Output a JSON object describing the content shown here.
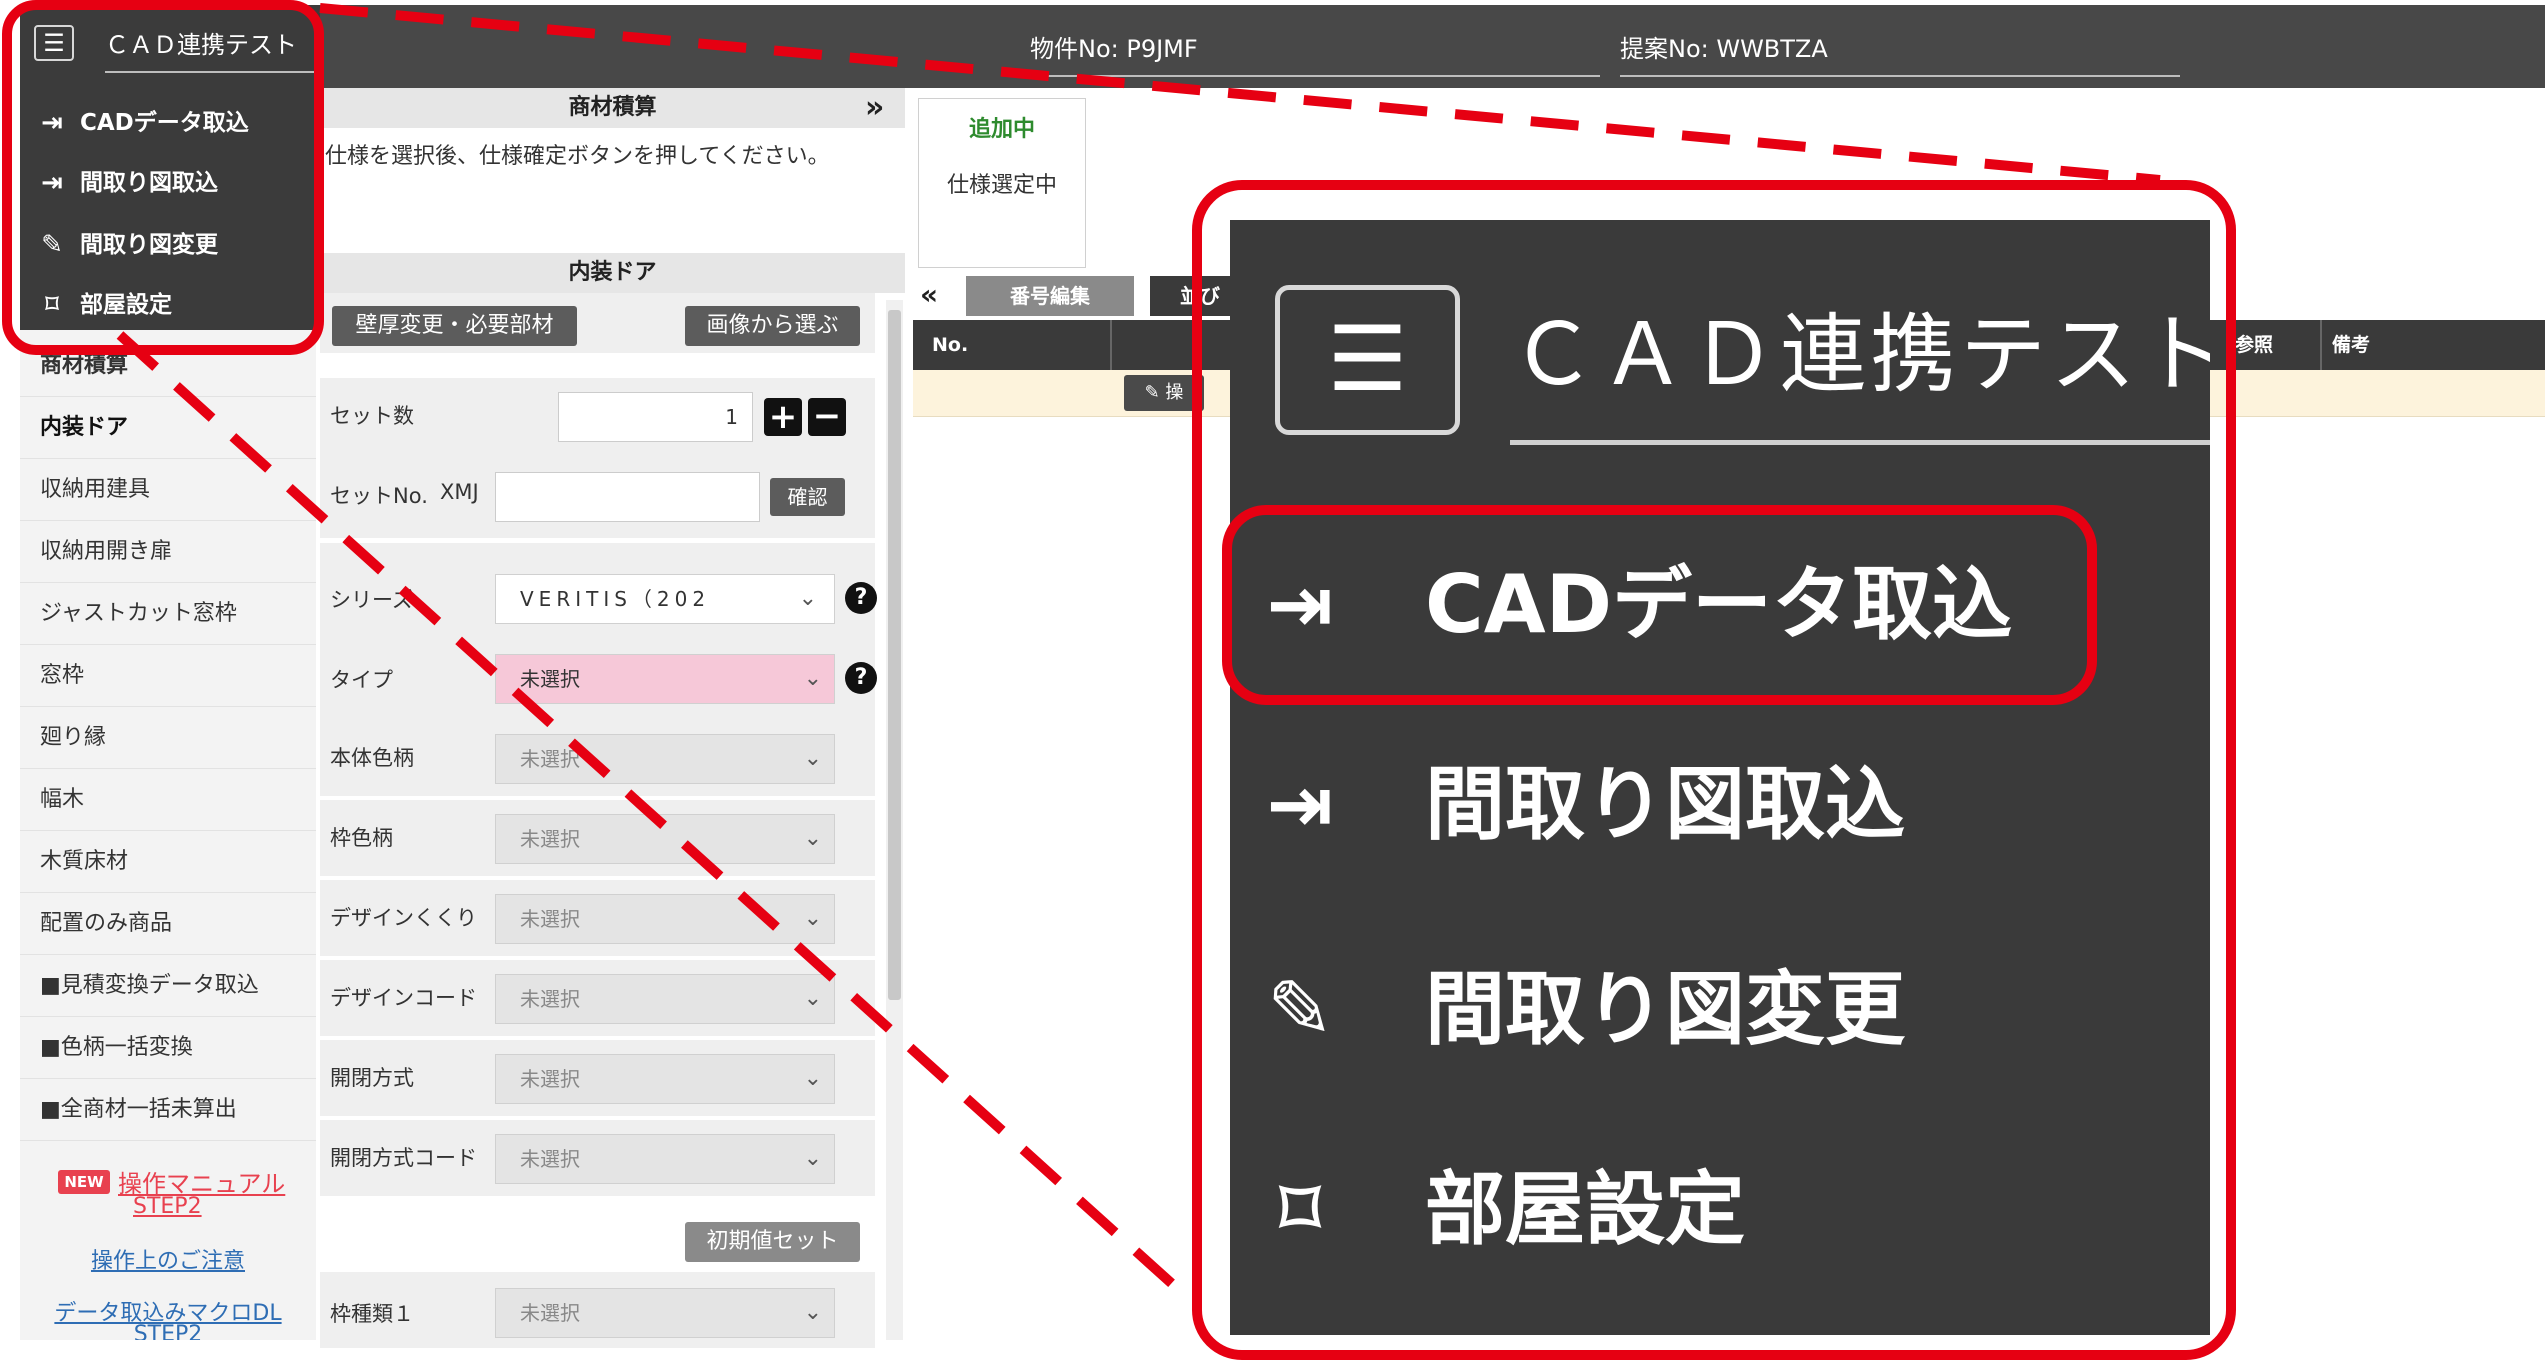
{
  "header": {
    "menu_icon": "hamburger-icon",
    "app_title": "ＣＡＤ連携テスト",
    "property_no": "物件No: P9JMF",
    "proposal_no": "提案No: WWBTZA"
  },
  "menu": {
    "items": [
      {
        "icon": "file-import-icon",
        "label": "CADデータ取込"
      },
      {
        "icon": "file-import-icon",
        "label": "間取り図取込"
      },
      {
        "icon": "edit-icon",
        "label": "間取り図変更"
      },
      {
        "icon": "room-shape-icon",
        "label": "部屋設定"
      }
    ]
  },
  "sidebar": {
    "items": [
      "商材積算",
      "内装ドア",
      "収納用建具",
      "収納用開き扉",
      "ジャストカット窓枠",
      "窓枠",
      "廻り縁",
      "幅木",
      "木質床材",
      "配置のみ商品",
      "■見積変換データ取込",
      "■色柄一括変換",
      "■全商材一括未算出"
    ],
    "new_badge": "NEW",
    "manual_link": "操作マニュアル",
    "manual_step": "STEP2",
    "notes_link": "操作上のご注意",
    "macro_link": "データ取込みマクロDL",
    "macro_step": "STEP2"
  },
  "form": {
    "section1_title": "商材積算",
    "collapse_icon": "»",
    "instruction": "仕様を選択後、仕様確定ボタンを押してください。",
    "section2_title": "内装ドア",
    "wall_button": "壁厚変更・必要部材",
    "image_button": "画像から選ぶ",
    "set_count_label": "セット数",
    "set_count_value": "1",
    "set_no_label": "セットNo.",
    "set_no_prefix": "XMJ",
    "confirm_button": "確認",
    "init_button": "初期値セット",
    "rows": [
      {
        "label": "シリーズ",
        "value": "VERITIS（202"
      },
      {
        "label": "タイプ",
        "value": "未選択"
      },
      {
        "label": "本体色柄",
        "value": "未選択"
      },
      {
        "label": "枠色柄",
        "value": "未選択"
      },
      {
        "label": "デザインくくり",
        "value": "未選択"
      },
      {
        "label": "デザインコード",
        "value": "未選択"
      },
      {
        "label": "開閉方式",
        "value": "未選択"
      },
      {
        "label": "開閉方式コード",
        "value": "未選択"
      },
      {
        "label": "枠種類１",
        "value": "未選択"
      }
    ],
    "pink_color": "#f6c8d8"
  },
  "right": {
    "adding": "追加中",
    "selecting": "仕様選定中",
    "expand_icon": "«",
    "number_edit_tab": "番号編集",
    "next_tab": "並び",
    "col_no": "No.",
    "col_ref": "参照",
    "col_note": "備考",
    "row_button": "操"
  },
  "colors": {
    "highlight": "#e60012",
    "dark": "#3b3b3b",
    "adding_green": "#2e8b2e"
  }
}
